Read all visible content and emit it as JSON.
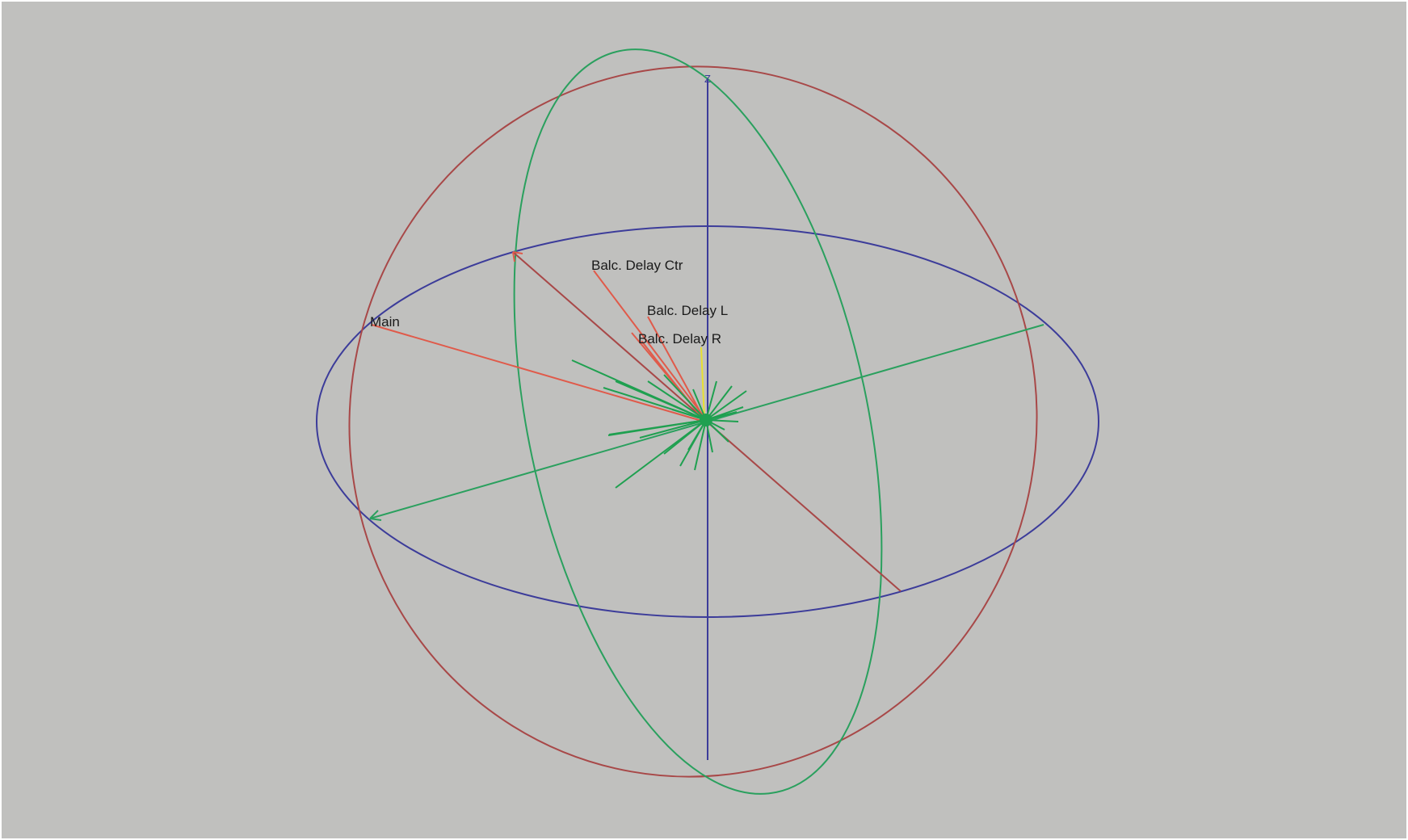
{
  "labels": {
    "main": "Main",
    "balc_delay_ctr": "Balc. Delay Ctr",
    "balc_delay_l": "Balc. Delay L",
    "balc_delay_r": "Balc. Delay R",
    "z_axis": "Z"
  },
  "colors": {
    "background": "#c0c0be",
    "blue_ring": "#3c3c9a",
    "red_ring": "#a84848",
    "green_ring": "#2aa05e",
    "speaker_aim": "#e05a4a",
    "ray": "#1fa050",
    "yellow_ray": "#e8e030",
    "label_text": "#1a1a1a"
  }
}
